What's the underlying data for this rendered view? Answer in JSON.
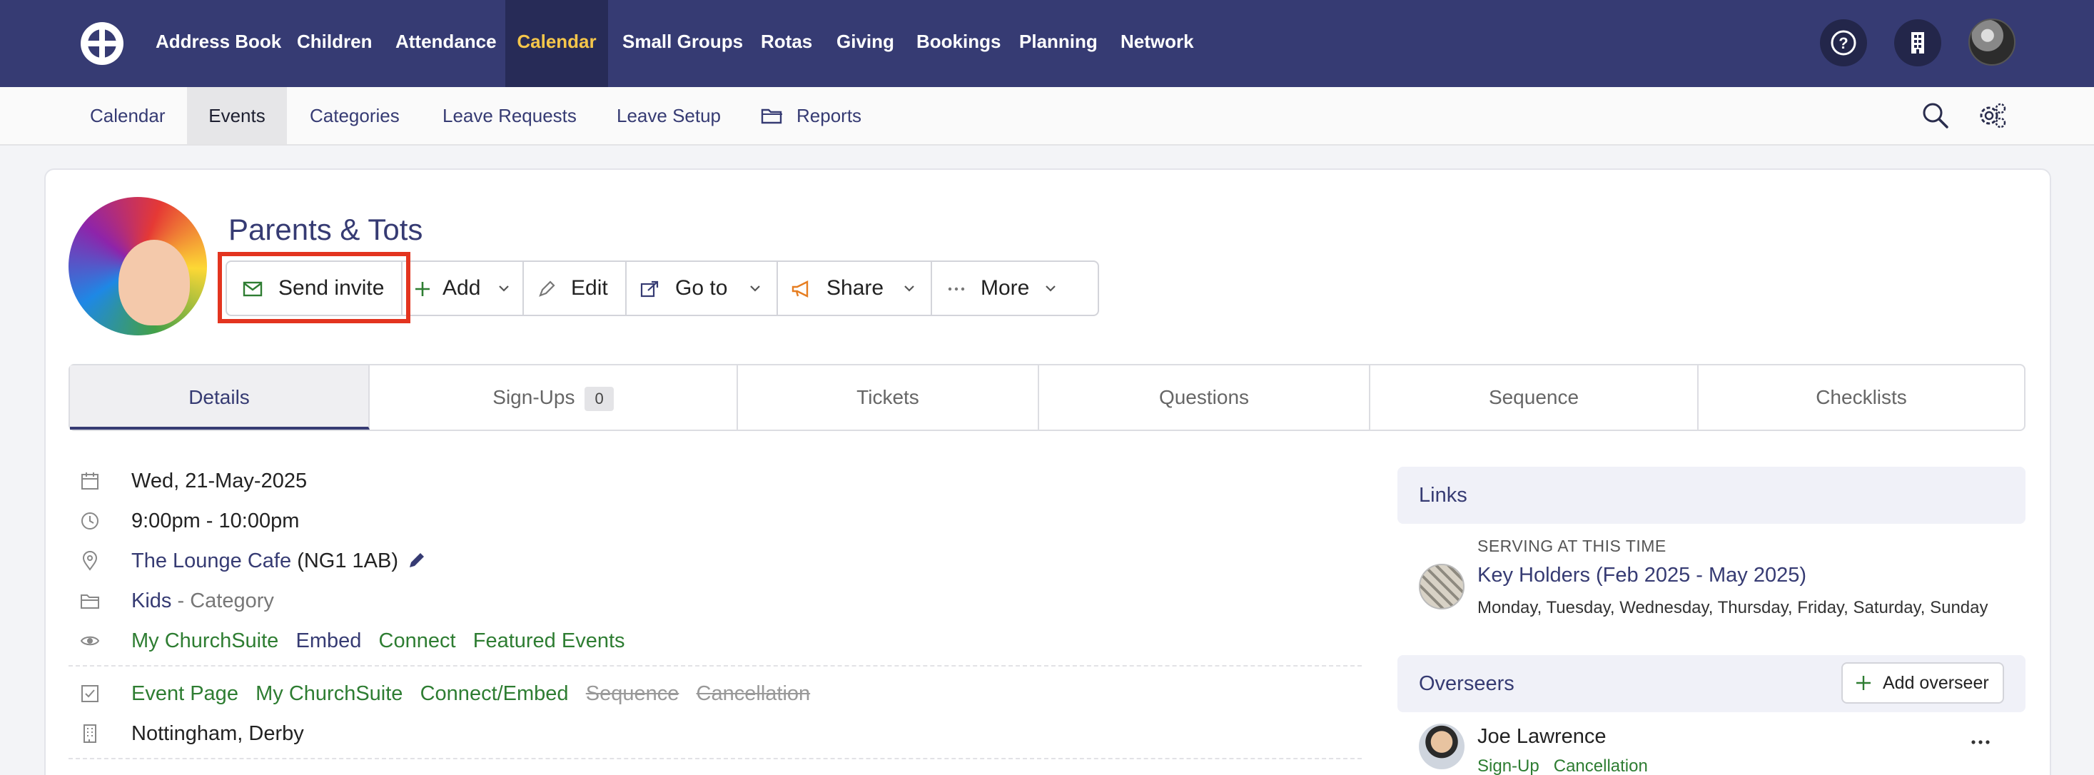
{
  "topnav": {
    "items": [
      "Address Book",
      "Children",
      "Attendance",
      "Calendar",
      "Small Groups",
      "Rotas",
      "Giving",
      "Bookings",
      "Planning",
      "Network"
    ],
    "active": "Calendar",
    "icons": [
      "help-icon",
      "building-icon",
      "user-avatar"
    ]
  },
  "subnav": {
    "items": [
      "Calendar",
      "Events",
      "Categories",
      "Leave Requests",
      "Leave Setup",
      "Reports"
    ],
    "active": "Events"
  },
  "event": {
    "title": "Parents & Tots"
  },
  "actions": {
    "send_invite": "Send invite",
    "add": "Add",
    "edit": "Edit",
    "goto": "Go to",
    "share": "Share",
    "more": "More"
  },
  "tabs": {
    "details": "Details",
    "signups": "Sign-Ups",
    "signups_count": "0",
    "tickets": "Tickets",
    "questions": "Questions",
    "sequence": "Sequence",
    "checklists": "Checklists"
  },
  "details": {
    "date": "Wed, 21-May-2025",
    "time": "9:00pm - 10:00pm",
    "location_name": "The Lounge Cafe",
    "location_postcode": "(NG1 1AB)",
    "category": "Kids",
    "category_suffix": "- Category",
    "visibility": [
      "My ChurchSuite",
      "Embed",
      "Connect",
      "Featured Events"
    ],
    "features_enabled": [
      "Event Page",
      "My ChurchSuite",
      "Connect/Embed"
    ],
    "features_disabled": [
      "Sequence",
      "Cancellation"
    ],
    "sites": "Nottingham, Derby"
  },
  "links_panel": {
    "heading": "Links",
    "serving_caption": "SERVING AT THIS TIME",
    "rota_name": "Key Holders (Feb 2025 - May 2025)",
    "rota_days": "Monday, Tuesday, Wednesday, Thursday, Friday, Saturday, Sunday"
  },
  "overseers_panel": {
    "heading": "Overseers",
    "add_button": "Add overseer",
    "person_name": "Joe Lawrence",
    "person_tags": [
      "Sign-Up",
      "Cancellation"
    ]
  },
  "colors": {
    "nav_bg": "#363b73",
    "nav_active_text": "#f5c64a",
    "link": "#363b73",
    "enabled_green": "#2e7d32",
    "highlight": "#e3341f"
  }
}
